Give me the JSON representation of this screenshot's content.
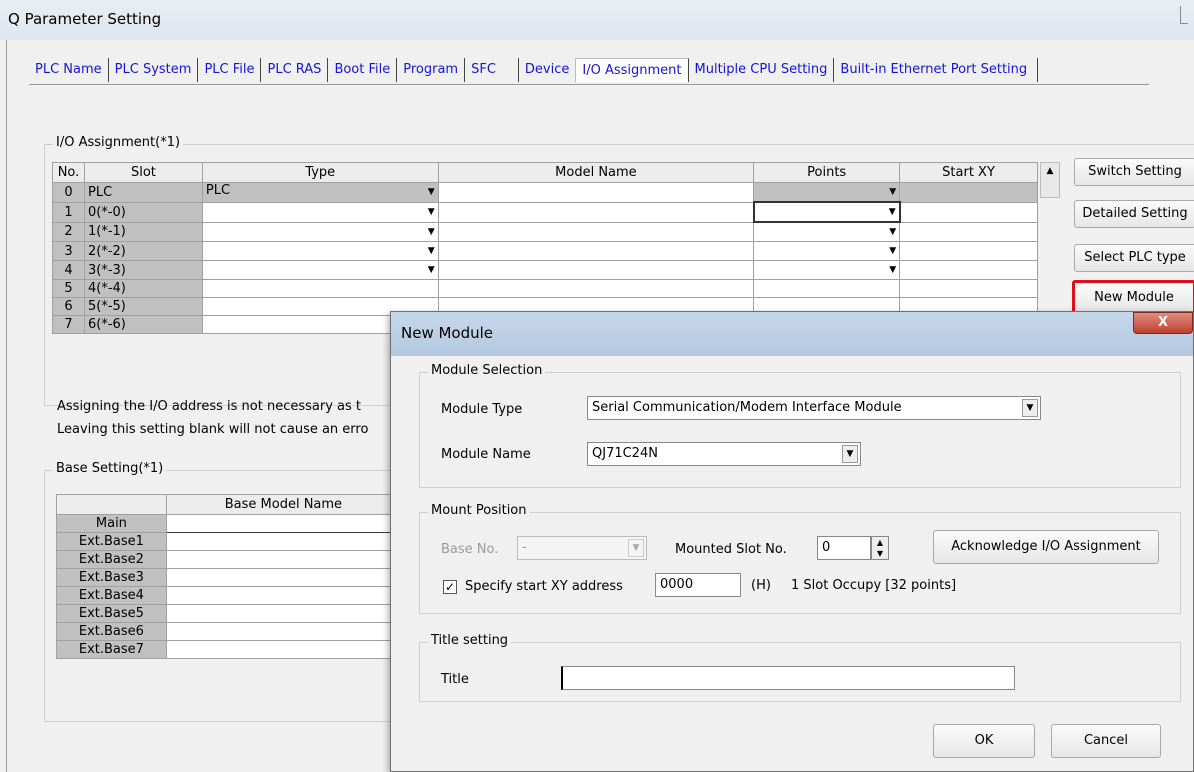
{
  "window": {
    "title": "Q Parameter Setting"
  },
  "tabs": [
    "PLC Name",
    "PLC System",
    "PLC File",
    "PLC RAS",
    "Boot File",
    "Program",
    "SFC",
    "Device",
    "I/O Assignment",
    "Multiple CPU Setting",
    "Built-in Ethernet Port Setting"
  ],
  "io": {
    "legend": "I/O Assignment(*1)",
    "headers": {
      "no": "No.",
      "slot": "Slot",
      "type": "Type",
      "model": "Model Name",
      "points": "Points",
      "start": "Start XY"
    },
    "rows": [
      {
        "no": "0",
        "slot": "PLC",
        "type": "PLC"
      },
      {
        "no": "1",
        "slot": "0(*-0)",
        "type": ""
      },
      {
        "no": "2",
        "slot": "1(*-1)",
        "type": ""
      },
      {
        "no": "3",
        "slot": "2(*-2)",
        "type": ""
      },
      {
        "no": "4",
        "slot": "3(*-3)",
        "type": ""
      },
      {
        "no": "5",
        "slot": "4(*-4)",
        "type": ""
      },
      {
        "no": "6",
        "slot": "5(*-5)",
        "type": ""
      },
      {
        "no": "7",
        "slot": "6(*-6)",
        "type": ""
      }
    ],
    "buttons": {
      "switch": "Switch Setting",
      "detailed": "Detailed Setting",
      "select_plc": "Select PLC type",
      "new_module": "New Module"
    },
    "note_line1": "Assigning the I/O address is not necessary as t",
    "note_line2": "Leaving this setting blank will not cause an erro"
  },
  "base": {
    "legend": "Base Setting(*1)",
    "header": "Base Model Name",
    "rows": [
      "Main",
      "Ext.Base1",
      "Ext.Base2",
      "Ext.Base3",
      "Ext.Base4",
      "Ext.Base5",
      "Ext.Base6",
      "Ext.Base7"
    ]
  },
  "dialog": {
    "title": "New Module",
    "close": "X",
    "module_selection": {
      "legend": "Module Selection",
      "type_label": "Module Type",
      "type_value": "Serial Communication/Modem Interface Module",
      "name_label": "Module Name",
      "name_value": "QJ71C24N"
    },
    "mount": {
      "legend": "Mount Position",
      "base_label": "Base No.",
      "base_value": "-",
      "slot_label": "Mounted Slot No.",
      "slot_value": "0",
      "ack_button": "Acknowledge I/O Assignment",
      "specify_label": "Specify start XY address",
      "specify_checked": true,
      "address_value": "0000",
      "hex_label": "(H)",
      "occupy_text": "1 Slot Occupy [32 points]"
    },
    "title_setting": {
      "legend": "Title setting",
      "label": "Title",
      "value": ""
    },
    "ok": "OK",
    "cancel": "Cancel"
  },
  "colors": {
    "tab_text": "#1515d8",
    "highlight_border": "#e0101a",
    "grid_gray": "#c0c0c0"
  }
}
